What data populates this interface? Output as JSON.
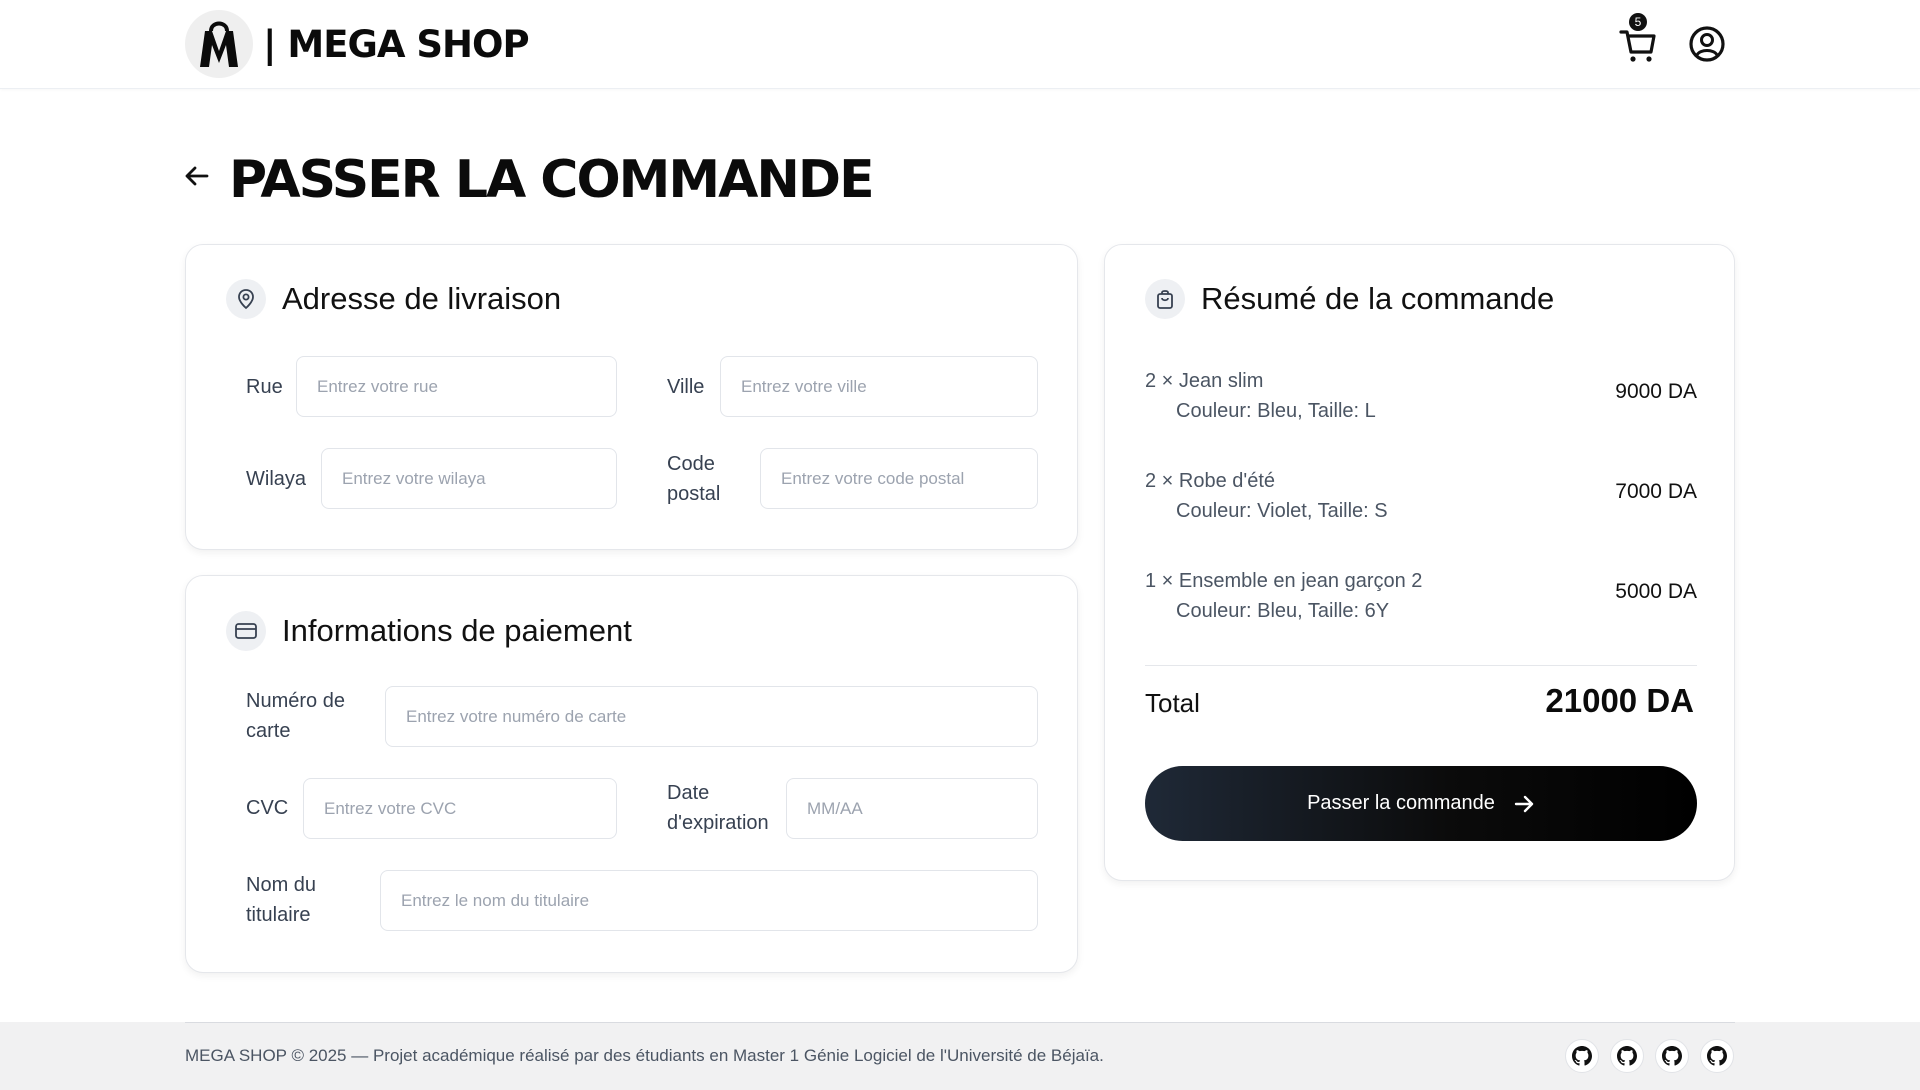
{
  "header": {
    "brand": "| MEGA SHOP",
    "cart_count": "5"
  },
  "page": {
    "title": "PASSER LA COMMANDE"
  },
  "shipping": {
    "title": "Adresse de livraison",
    "street_label": "Rue",
    "street_placeholder": "Entrez votre rue",
    "city_label": "Ville",
    "city_placeholder": "Entrez votre ville",
    "wilaya_label": "Wilaya",
    "wilaya_placeholder": "Entrez votre wilaya",
    "postal_label_line1": "Code",
    "postal_label_line2": "postal",
    "postal_placeholder": "Entrez votre code postal"
  },
  "payment": {
    "title": "Informations de paiement",
    "card_label_line1": "Numéro de",
    "card_label_line2": "carte",
    "card_placeholder": "Entrez votre numéro de carte",
    "cvc_label": "CVC",
    "cvc_placeholder": "Entrez votre CVC",
    "expiry_label_line1": "Date",
    "expiry_label_line2": "d'expiration",
    "expiry_placeholder": "MM/AA",
    "holder_label_line1": "Nom du",
    "holder_label_line2": "titulaire",
    "holder_placeholder": "Entrez le nom du titulaire"
  },
  "summary": {
    "title": "Résumé de la commande",
    "items": [
      {
        "line": "2 × Jean slim",
        "variant": "Couleur: Bleu, Taille: L",
        "price": "9000 DA"
      },
      {
        "line": "2 × Robe d'été",
        "variant": "Couleur: Violet, Taille: S",
        "price": "7000 DA"
      },
      {
        "line": "1 × Ensemble en jean garçon 2",
        "variant": "Couleur: Bleu, Taille: 6Y",
        "price": "5000 DA"
      }
    ],
    "total_label": "Total",
    "total_value": "21000 DA",
    "order_button": "Passer la commande"
  },
  "footer": {
    "text": "MEGA SHOP © 2025 — Projet académique réalisé par des étudiants en Master 1 Génie Logiciel de l'Université de Béjaïa."
  }
}
